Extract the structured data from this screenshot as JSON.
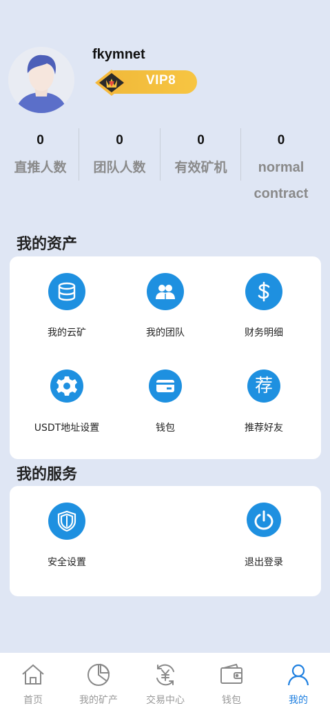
{
  "profile": {
    "username": "fkymnet",
    "vip_label": "VIP8"
  },
  "stats": [
    {
      "value": "0",
      "label": "直推人数"
    },
    {
      "value": "0",
      "label": "团队人数"
    },
    {
      "value": "0",
      "label": "有效矿机"
    },
    {
      "value": "0",
      "label": "normal contract"
    }
  ],
  "assets": {
    "title": "我的资产",
    "items": [
      {
        "label": "我的云矿",
        "icon": "database-icon"
      },
      {
        "label": "我的团队",
        "icon": "team-icon"
      },
      {
        "label": "财务明细",
        "icon": "dollar-icon"
      },
      {
        "label": "USDT地址设置",
        "icon": "gear-icon"
      },
      {
        "label": "钱包",
        "icon": "card-icon"
      },
      {
        "label": "推荐好友",
        "icon": "recommend-icon"
      }
    ]
  },
  "services": {
    "title": "我的服务",
    "items": [
      {
        "label": "安全设置",
        "icon": "shield-icon"
      },
      {
        "label": "退出登录",
        "icon": "power-icon"
      }
    ]
  },
  "recommend_glyph": "荐",
  "nav": {
    "items": [
      {
        "label": "首页",
        "icon": "home-icon"
      },
      {
        "label": "我的矿产",
        "icon": "pie-chart-icon"
      },
      {
        "label": "交易中心",
        "icon": "exchange-icon"
      },
      {
        "label": "钱包",
        "icon": "wallet-icon"
      },
      {
        "label": "我的",
        "icon": "user-icon"
      }
    ],
    "active_index": 4
  },
  "colors": {
    "background": "#dfe6f4",
    "accent": "#1e90e0",
    "vip_gold": "#f0b93a",
    "nav_active": "#1e7fe0"
  }
}
